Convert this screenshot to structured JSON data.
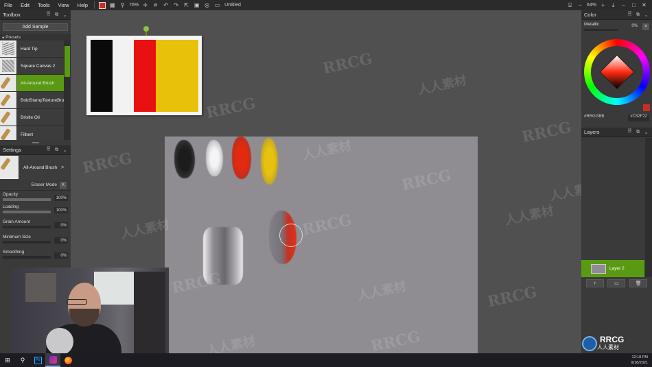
{
  "menu": {
    "items": [
      "File",
      "Edit",
      "Tools",
      "View",
      "Help"
    ],
    "zoom": "76%",
    "doc_title": "Untitled",
    "right_zoom": "64%"
  },
  "toolbox": {
    "title": "Toolbox",
    "add_sample": "Add Sample",
    "presets_header": "Presets",
    "presets": [
      {
        "label": "Hard Tip",
        "thumb": "stroke"
      },
      {
        "label": "Square Canvas 2",
        "thumb": "texture"
      },
      {
        "label": "All-Around Brush",
        "thumb": "brush",
        "active": true
      },
      {
        "label": "BoldStampTextureBrush",
        "thumb": "brush"
      },
      {
        "label": "Bristle Oil",
        "thumb": "brush"
      },
      {
        "label": "Filbert",
        "thumb": "brush"
      }
    ]
  },
  "settings": {
    "title": "Settings",
    "brush_name": "All-Around Brush",
    "brush_arrow": ">",
    "eraser_mode": "Eraser Mode",
    "eraser_x": "X",
    "sliders": [
      {
        "label": "Opacity",
        "value": "100%",
        "fraction": 1.0
      },
      {
        "label": "Loading",
        "value": "100%",
        "fraction": 1.0
      },
      {
        "label": "Grain Amount",
        "value": "0%",
        "fraction": 0.0
      },
      {
        "label": "Minimum Size",
        "value": "0%",
        "fraction": 0.0
      },
      {
        "label": "Smoothing",
        "value": "0%",
        "fraction": 0.0
      }
    ]
  },
  "color": {
    "title": "Color",
    "metallic_label": "Metallic",
    "metallic_value": "0%",
    "hex_format": "#RRGGBB",
    "hex_value": "#C82F22",
    "current": "#c82f22"
  },
  "layers": {
    "title": "Layers",
    "items": [
      {
        "label": "Layer 2",
        "active": true
      }
    ],
    "buttons": [
      "+",
      "▭",
      "🗑"
    ]
  },
  "reference_colors": [
    "#0a0a0a",
    "#f2f2f2",
    "#e81010",
    "#e8c20a"
  ],
  "taskbar": {
    "time": "12:18 PM",
    "date": "9/18/2021"
  },
  "watermarks": {
    "latin": "RRCG",
    "cn": "人人素材"
  },
  "logo": {
    "name": "RRCG",
    "sub": "人人素材"
  }
}
